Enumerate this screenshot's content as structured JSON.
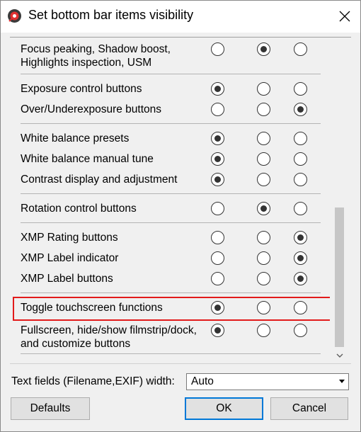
{
  "window": {
    "title": "Set bottom bar items visibility",
    "icon": "app-logo-icon",
    "close_icon": "close-icon"
  },
  "rows": [
    {
      "label_lines": [
        "Focus peaking, Shadow boost,",
        "Highlights inspection, USM"
      ],
      "selected": 1
    },
    {
      "label_lines": [
        "Exposure control buttons"
      ],
      "selected": 0
    },
    {
      "label_lines": [
        "Over/Underexposure buttons"
      ],
      "selected": 2
    },
    {
      "label_lines": [
        "White balance presets"
      ],
      "selected": 0
    },
    {
      "label_lines": [
        "White balance manual tune"
      ],
      "selected": 0
    },
    {
      "label_lines": [
        "Contrast display and adjustment"
      ],
      "selected": 0
    },
    {
      "label_lines": [
        "Rotation control buttons"
      ],
      "selected": 1
    },
    {
      "label_lines": [
        "XMP Rating buttons"
      ],
      "selected": 2
    },
    {
      "label_lines": [
        "XMP Label indicator"
      ],
      "selected": 2
    },
    {
      "label_lines": [
        "XMP Label buttons"
      ],
      "selected": 2
    },
    {
      "label_lines": [
        "Toggle touchscreen functions"
      ],
      "selected": 0,
      "highlighted": true
    },
    {
      "label_lines": [
        "Fullscreen, hide/show filmstrip/dock,",
        "and customize buttons"
      ],
      "selected": 0
    }
  ],
  "text_fields": {
    "label": "Text fields (Filename,EXIF) width:",
    "value": "Auto"
  },
  "buttons": {
    "defaults": "Defaults",
    "ok": "OK",
    "cancel": "Cancel"
  },
  "colors": {
    "highlight_border": "#e21b1b",
    "default_button_border": "#0078d7"
  }
}
